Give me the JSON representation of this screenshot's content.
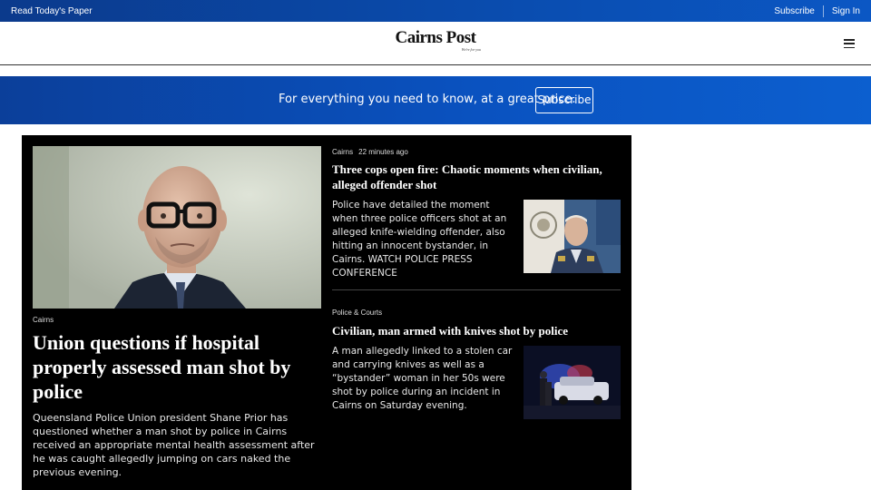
{
  "topbar": {
    "read_paper": "Read Today's Paper",
    "subscribe": "Subscribe",
    "sign_in": "Sign In"
  },
  "header": {
    "logo": "Cairns Post",
    "tagline": "We're for you",
    "menu_icon": "hamburger-menu-icon"
  },
  "promo": {
    "text": "For everything you need to know, at a great price.",
    "button": "Subscribe"
  },
  "colors": {
    "brand_blue": "#0a4db0",
    "panel_bg": "#000000"
  },
  "lead": {
    "category": "Cairns",
    "title": "Union questions if hospital properly assessed man shot by police",
    "description": "Queensland Police Union president Shane Prior has questioned whether a man shot by police in Cairns received an appropriate mental health assessment after he was caught allegedly jumping on cars naked the previous evening."
  },
  "stories": [
    {
      "category": "Cairns",
      "time": "22 minutes ago",
      "title": "Three cops open fire: Chaotic moments when civilian, alleged offender shot",
      "description": "Police have detailed the moment when three police officers shot at an alleged knife-wielding offender, also hitting an innocent bystander, in Cairns. WATCH POLICE PRESS CONFERENCE"
    },
    {
      "category": "Police & Courts",
      "time": "",
      "title": "Civilian, man armed with knives shot by police",
      "description": "A man allegedly linked to a stolen car and carrying knives as well as a “bystander” woman in her 50s were shot by police during an incident in Cairns on Saturday evening."
    }
  ]
}
